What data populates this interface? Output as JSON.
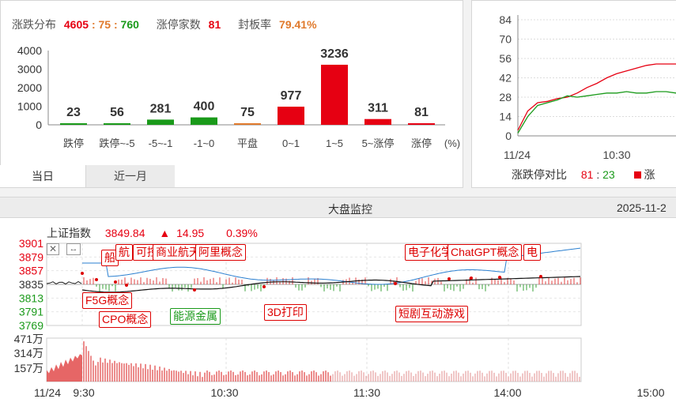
{
  "stats": {
    "dist_label": "涨跌分布",
    "dist_up": "4605",
    "dist_sep1": ":",
    "dist_flat": "75",
    "dist_sep2": ":",
    "dist_down": "760",
    "limit_label": "涨停家数",
    "limit_value": "81",
    "seal_label": "封板率",
    "seal_value": "79.41%"
  },
  "chart_data": [
    {
      "type": "bar",
      "categories": [
        "跌停",
        "跌停~-5",
        "-5~-1",
        "-1~0",
        "平盘",
        "0~1",
        "1~5",
        "5~涨停",
        "涨停"
      ],
      "values": [
        23,
        56,
        281,
        400,
        75,
        977,
        3236,
        311,
        81
      ],
      "unit_label": "(%)",
      "ylim": [
        0,
        4000
      ],
      "yticks": [
        "0",
        "1000",
        "2000",
        "3000",
        "4000"
      ],
      "colors": [
        "#1a9a1a",
        "#1a9a1a",
        "#1a9a1a",
        "#1a9a1a",
        "#e07a2c",
        "#e60012",
        "#e60012",
        "#e60012",
        "#e60012"
      ]
    },
    {
      "type": "line",
      "x_ticks": [
        "11/24",
        "10:30"
      ],
      "yticks": [
        "84",
        "70",
        "56",
        "42",
        "28",
        "14",
        "0"
      ],
      "ylim": [
        0,
        84
      ],
      "series": [
        {
          "color": "#e60012",
          "values": [
            4,
            18,
            24,
            25,
            27,
            28,
            31,
            35,
            38,
            42,
            45,
            47,
            49,
            51,
            52,
            52,
            52
          ]
        },
        {
          "color": "#1a9a1a",
          "values": [
            2,
            14,
            22,
            24,
            26,
            29,
            28,
            29,
            30,
            31,
            31,
            32,
            31,
            31,
            32,
            32,
            31
          ]
        }
      ],
      "legend_label": "涨跌停对比",
      "legend_up": "81",
      "legend_sep": ":",
      "legend_down": "23",
      "legend_extra": "涨"
    }
  ],
  "tabs": [
    {
      "label": "当日"
    },
    {
      "label": "近一月"
    }
  ],
  "monitor": {
    "title": "大盘监控",
    "date": "2025-11-2",
    "index_name": "上证指数",
    "index_value": "3849.84",
    "change_arrow": "▲",
    "change_value": "14.95",
    "change_pct": "0.39%",
    "price_ticks": [
      "3901",
      "3879",
      "3857",
      "3835",
      "3813",
      "3791",
      "3769"
    ],
    "vol_ticks": [
      "471万",
      "314万",
      "157万"
    ],
    "time_ticks": [
      "11/24",
      "9:30",
      "10:30",
      "11:30",
      "14:00",
      "15:00"
    ],
    "annotations": [
      {
        "label": "船"
      },
      {
        "label": "航"
      },
      {
        "label": "可控"
      },
      {
        "label": "商业航天"
      },
      {
        "label": "阿里概念"
      },
      {
        "label": "F5G概念"
      },
      {
        "label": "CPO概念"
      },
      {
        "label": "能源金属"
      },
      {
        "label": "3D打印"
      },
      {
        "label": "电子化学品"
      },
      {
        "label": "ChatGPT概念"
      },
      {
        "label": "电"
      },
      {
        "label": "短剧互动游戏"
      }
    ]
  }
}
